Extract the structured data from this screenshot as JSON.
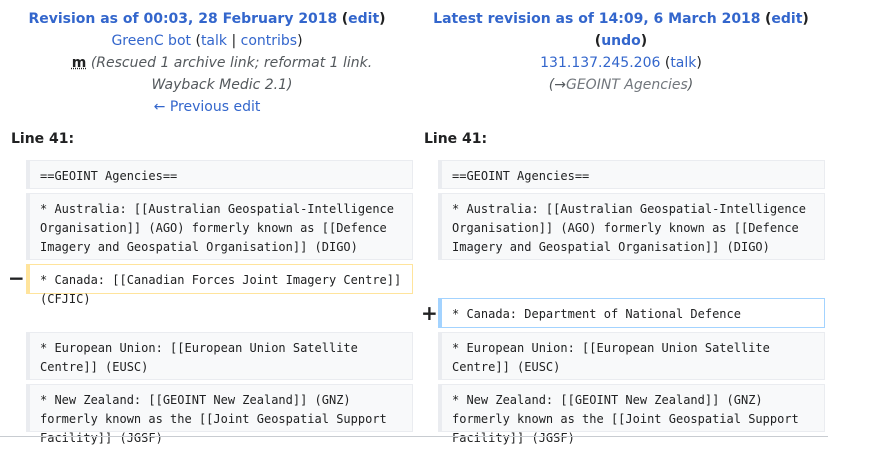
{
  "left": {
    "title_prefix": "Revision as of 00:03, 28 February 2018",
    "edit": "edit",
    "user": "GreenC bot",
    "talk": "talk",
    "contribs": "contribs",
    "minor": "m",
    "summary_text": "(Rescued 1 archive link; reformat 1 link.",
    "summary_link": "Wayback Medic 2.1",
    "summary_close": ")",
    "prev_edit": "← Previous edit"
  },
  "right": {
    "title_prefix": "Latest revision as of 14:09, 6 March 2018",
    "edit": "edit",
    "undo": "undo",
    "user": "131.137.245.206",
    "talk": "talk",
    "section_arrow": "→",
    "section": "GEOINT Agencies"
  },
  "line_label_left": "Line 41:",
  "line_label_right": "Line 41:",
  "diff": {
    "ctx1_left": "==GEOINT Agencies==",
    "ctx1_right": "==GEOINT Agencies==",
    "ctx2_left": "* Australia: [[Australian Geospatial-Intelligence Organisation]] (AGO) formerly known as [[Defence Imagery and Geospatial Organisation]] (DIGO)",
    "ctx2_right": "* Australia: [[Australian Geospatial-Intelligence Organisation]] (AGO) formerly known as [[Defence Imagery and Geospatial Organisation]] (DIGO)",
    "del_marker": "−",
    "del_line": "* Canada: [[Canadian Forces Joint Imagery Centre]] (CFJIC)",
    "add_marker": "+",
    "add_line": "* Canada: Department of National Defence",
    "ctx3_left": "* European Union: [[European Union Satellite Centre]] (EUSC)",
    "ctx3_right": "* European Union: [[European Union Satellite Centre]] (EUSC)",
    "ctx4_left": "* New Zealand: [[GEOINT New Zealand]] (GNZ) formerly known as the [[Joint Geospatial Support Facility]] (JGSF)",
    "ctx4_right": "* New Zealand: [[GEOINT New Zealand]] (GNZ) formerly known as the [[Joint Geospatial Support Facility]] (JGSF)"
  }
}
